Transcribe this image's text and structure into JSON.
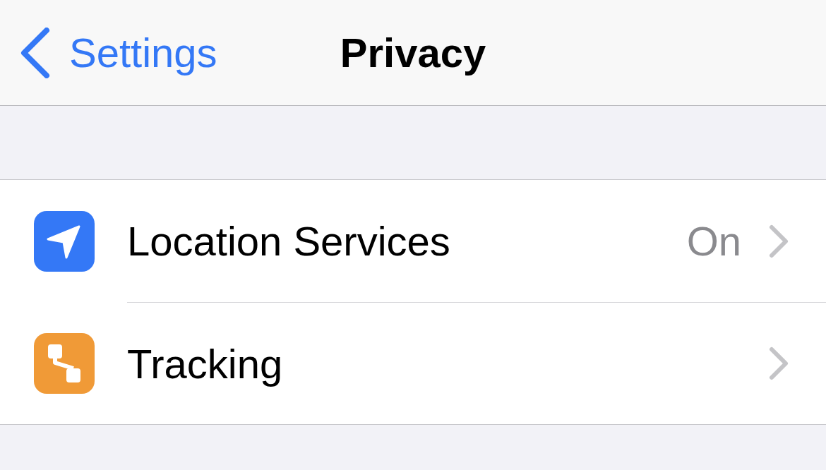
{
  "nav": {
    "back_label": "Settings",
    "title": "Privacy"
  },
  "rows": [
    {
      "label": "Location Services",
      "value": "On",
      "color": "#3478f6"
    },
    {
      "label": "Tracking",
      "color": "#f09a37"
    }
  ]
}
